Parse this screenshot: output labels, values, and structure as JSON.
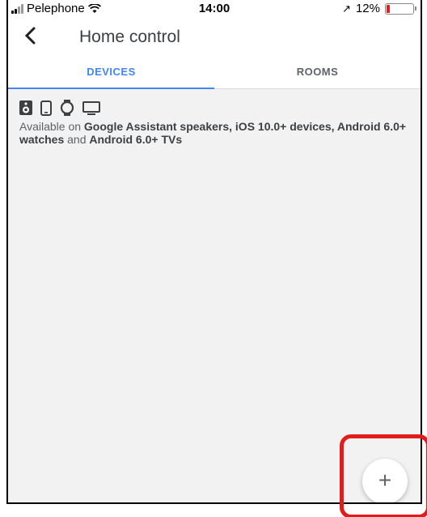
{
  "status_bar": {
    "carrier": "Pelephone",
    "time": "14:00",
    "battery": "12%",
    "battery_level": 0.12,
    "location_arrow": "↗"
  },
  "app_bar": {
    "back_icon": "chevron-left",
    "title": "Home control"
  },
  "tabs": [
    {
      "label": "DEVICES",
      "selected": true
    },
    {
      "label": "ROOMS",
      "selected": false
    }
  ],
  "device_types": [
    "speaker-icon",
    "phone-icon",
    "watch-icon",
    "tv-icon"
  ],
  "availability": {
    "prefix": "Available on ",
    "part1": "Google Assistant speakers, iOS 10.0+ devices, Android 6.0+ watches",
    "middle": " and ",
    "part2": "Android 6.0+ TVs"
  },
  "fab": {
    "icon": "plus-icon",
    "glyph": "+"
  },
  "colors": {
    "accent": "#4285f4",
    "highlight": "#e21b1b",
    "battery_low": "#e0201f"
  }
}
